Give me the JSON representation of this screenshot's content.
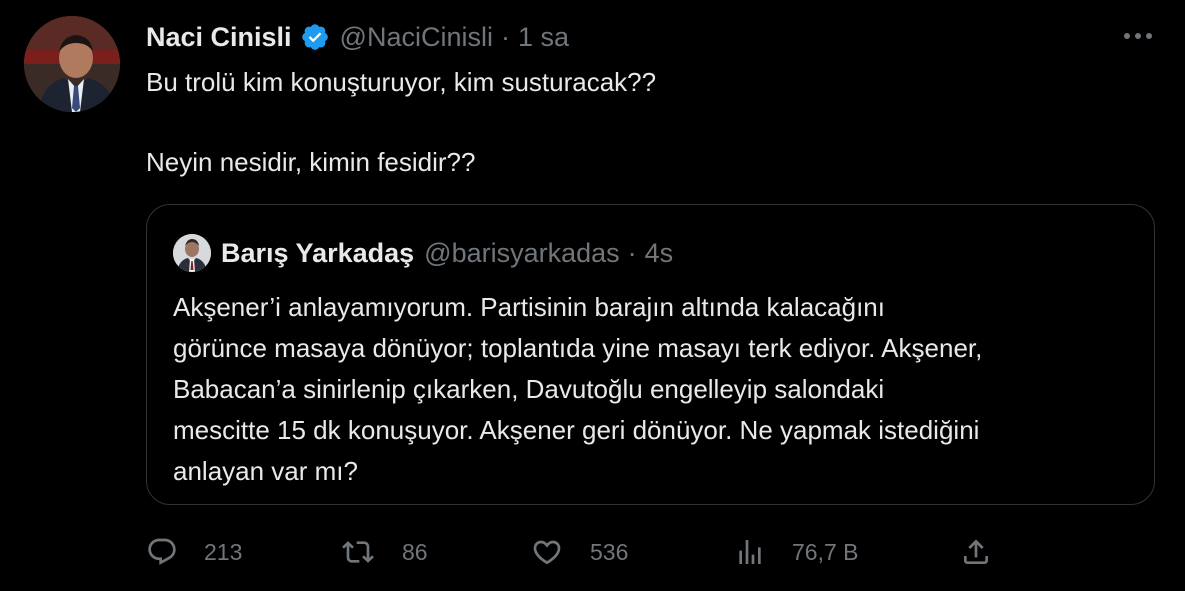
{
  "tweet": {
    "author": {
      "display_name": "Naci Cinisli",
      "handle": "@NaciCinisli",
      "verified": true,
      "avatar_icon": "avatar-photo"
    },
    "separator": "·",
    "time": "1 sa",
    "more_icon": "more-dots-icon",
    "text_lines": [
      "Bu trolü kim konuşturuyor, kim susturacak??",
      "Neyin nesidir, kimin fesidir??"
    ]
  },
  "quote": {
    "author": {
      "display_name": "Barış Yarkadaş",
      "handle": "@barisyarkadas"
    },
    "separator": "·",
    "time": "4s",
    "text_lines": [
      "Akşener’i anlayamıyorum. Partisinin barajın altında kalacağını",
      "görünce masaya dönüyor; toplantıda yine masayı terk ediyor. Akşener,",
      "Babacan’a sinirlenip çıkarken, Davutoğlu engelleyip salondaki",
      "mescitte 15 dk konuşuyor. Akşener geri dönüyor.  Ne yapmak istediğini",
      "anlayan var mı?"
    ]
  },
  "actions": {
    "reply": {
      "icon": "reply-icon",
      "count": "213"
    },
    "retweet": {
      "icon": "retweet-icon",
      "count": "86"
    },
    "like": {
      "icon": "heart-icon",
      "count": "536"
    },
    "views": {
      "icon": "views-icon",
      "count": "76,7 B"
    },
    "share": {
      "icon": "share-icon"
    }
  },
  "colors": {
    "background": "#000000",
    "text_primary": "#e7e9ea",
    "text_secondary": "#71767b",
    "border": "#2f3336",
    "verified_badge": "#1d9bf0"
  }
}
